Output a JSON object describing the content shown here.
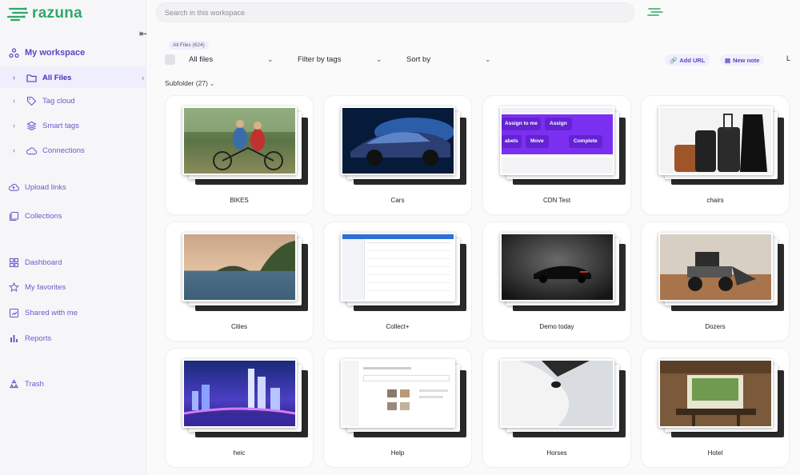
{
  "app": {
    "name": "razuna"
  },
  "search": {
    "placeholder": "Search in this workspace"
  },
  "sidebar": {
    "workspace": "My workspace",
    "sub": [
      {
        "label": "All Files",
        "icon": "folder-icon",
        "active": true
      },
      {
        "label": "Tag cloud",
        "icon": "tag-icon",
        "active": false
      },
      {
        "label": "Smart tags",
        "icon": "layers-icon",
        "active": false
      },
      {
        "label": "Connections",
        "icon": "cloud-icon",
        "active": false
      }
    ],
    "items": [
      {
        "label": "Upload links",
        "icon": "cloud-upload-icon"
      },
      {
        "label": "Collections",
        "icon": "collection-icon"
      },
      {
        "label": "Dashboard",
        "icon": "dashboard-icon"
      },
      {
        "label": "My favorites",
        "icon": "star-icon"
      },
      {
        "label": "Shared with me",
        "icon": "shared-icon"
      },
      {
        "label": "Reports",
        "icon": "reports-icon"
      },
      {
        "label": "Trash",
        "icon": "trash-icon"
      }
    ]
  },
  "toolbar": {
    "count": "All Files (624)",
    "files_select": "All files",
    "filter": "Filter by tags",
    "sort": "Sort by",
    "add_url": "Add URL",
    "new_note": "New note",
    "edge_letter": "L"
  },
  "subfolder": {
    "label": "Subfolder (27)"
  },
  "folders": [
    {
      "name": "BIKES",
      "thumb": "bikes"
    },
    {
      "name": "Cars",
      "thumb": "cars"
    },
    {
      "name": "CDN Test",
      "thumb": "cdn"
    },
    {
      "name": "chairs",
      "thumb": "chairs"
    },
    {
      "name": "Cities",
      "thumb": "cities"
    },
    {
      "name": "Collect+",
      "thumb": "collect"
    },
    {
      "name": "Demo today",
      "thumb": "demo"
    },
    {
      "name": "Dozers",
      "thumb": "dozers"
    },
    {
      "name": "heic",
      "thumb": "heic"
    },
    {
      "name": "Help",
      "thumb": "help"
    },
    {
      "name": "Horses",
      "thumb": "horses"
    },
    {
      "name": "Hotel",
      "thumb": "hotel"
    }
  ],
  "cdn_thumb_text": {
    "assign_to_me": "Assign to me",
    "assign": "Assign",
    "labels": "abels",
    "move": "Move",
    "complete": "Complete"
  },
  "colors": {
    "brand_green": "#2fa86a",
    "accent_purple": "#5b44c7"
  }
}
